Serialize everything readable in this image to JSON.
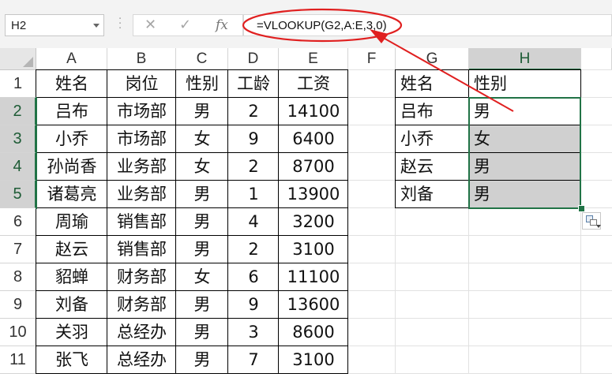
{
  "name_box": {
    "value": "H2"
  },
  "formula_bar": {
    "cancel_glyph": "✕",
    "enter_glyph": "✓",
    "fx_glyph": "fx",
    "formula": "=VLOOKUP(G2,A:E,3,0)"
  },
  "grid": {
    "columns": [
      "A",
      "B",
      "C",
      "D",
      "E",
      "F",
      "G",
      "H"
    ],
    "selected_column": "H",
    "rows": [
      "1",
      "2",
      "3",
      "4",
      "5",
      "6",
      "7",
      "8",
      "9",
      "10",
      "11"
    ],
    "selected_rows": [
      "2",
      "3",
      "4",
      "5"
    ],
    "table_headers": [
      "姓名",
      "岗位",
      "性别",
      "工龄",
      "工资"
    ],
    "table_rows": [
      [
        "吕布",
        "市场部",
        "男",
        "2",
        "14100"
      ],
      [
        "小乔",
        "市场部",
        "女",
        "9",
        "6400"
      ],
      [
        "孙尚香",
        "业务部",
        "女",
        "2",
        "8700"
      ],
      [
        "诸葛亮",
        "业务部",
        "男",
        "1",
        "13900"
      ],
      [
        "周瑜",
        "销售部",
        "男",
        "4",
        "3200"
      ],
      [
        "赵云",
        "销售部",
        "男",
        "2",
        "3100"
      ],
      [
        "貂蝉",
        "财务部",
        "女",
        "6",
        "11100"
      ],
      [
        "刘备",
        "财务部",
        "男",
        "9",
        "13600"
      ],
      [
        "关羽",
        "总经办",
        "男",
        "3",
        "8600"
      ],
      [
        "张飞",
        "总经办",
        "男",
        "7",
        "3100"
      ]
    ],
    "lookup_headers": [
      "姓名",
      "性别"
    ],
    "lookup_rows": [
      [
        "吕布",
        "男"
      ],
      [
        "小乔",
        "女"
      ],
      [
        "赵云",
        "男"
      ],
      [
        "刘备",
        "男"
      ]
    ]
  },
  "colors": {
    "selection": "#217346",
    "selected_fill": "#d0d0d0",
    "annotation": "#e02020"
  }
}
